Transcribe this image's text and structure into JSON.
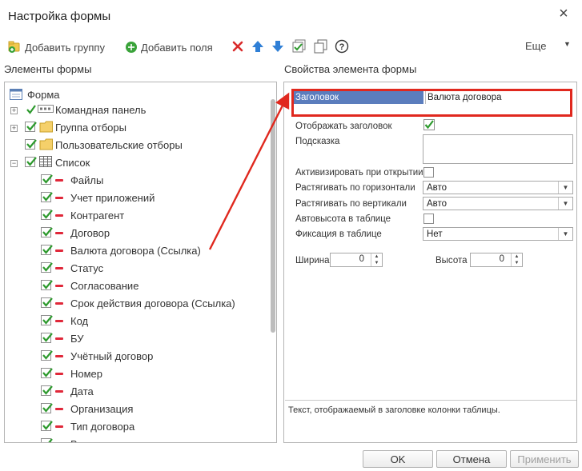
{
  "window": {
    "title": "Настройка формы",
    "close_glyph": "×"
  },
  "toolbar": {
    "add_group": "Добавить группу",
    "add_fields": "Добавить поля",
    "more": "Еще"
  },
  "left_panel": {
    "title": "Элементы формы",
    "tree": {
      "root": "Форма",
      "items": [
        {
          "label": "Командная панель"
        },
        {
          "label": "Группа отборы"
        },
        {
          "label": "Пользовательские отборы"
        },
        {
          "label": "Список"
        }
      ],
      "children": [
        "Файлы",
        "Учет приложений",
        "Контрагент",
        "Договор",
        "Валюта договора (Ссылка)",
        "Статус",
        "Согласование",
        "Срок действия договора (Ссылка)",
        "Код",
        "БУ",
        "Учётный договор",
        "Номер",
        "Дата",
        "Организация",
        "Тип договора",
        "В..."
      ],
      "selected": "Валюта договора (Ссылка)"
    }
  },
  "right_panel": {
    "title": "Свойства элемента формы",
    "heading_label": "Заголовок",
    "heading_value": "Валюта договора",
    "show_heading": "Отображать заголовок",
    "hint": "Подсказка",
    "activate_on_open": "Активизировать при открытии",
    "stretch_horizontal": "Растягивать по горизонтали",
    "stretch_horizontal_value": "Авто",
    "stretch_vertical": "Растягивать по вертикали",
    "stretch_vertical_value": "Авто",
    "auto_height": "Автовысота в таблице",
    "fixation": "Фиксация в таблице",
    "fixation_value": "Нет",
    "width_label": "Ширина",
    "width_value": "0",
    "height_label": "Высота",
    "height_value": "0",
    "description": "Текст, отображаемый в заголовке колонки таблицы."
  },
  "buttons": {
    "ok": "OK",
    "cancel": "Отмена",
    "apply": "Применить"
  },
  "colors": {
    "accent_red": "#e0281e",
    "selection_blue": "#5b7dbd",
    "highlight_yellow": "#fbeb87",
    "check_green": "#2e9a2e"
  }
}
